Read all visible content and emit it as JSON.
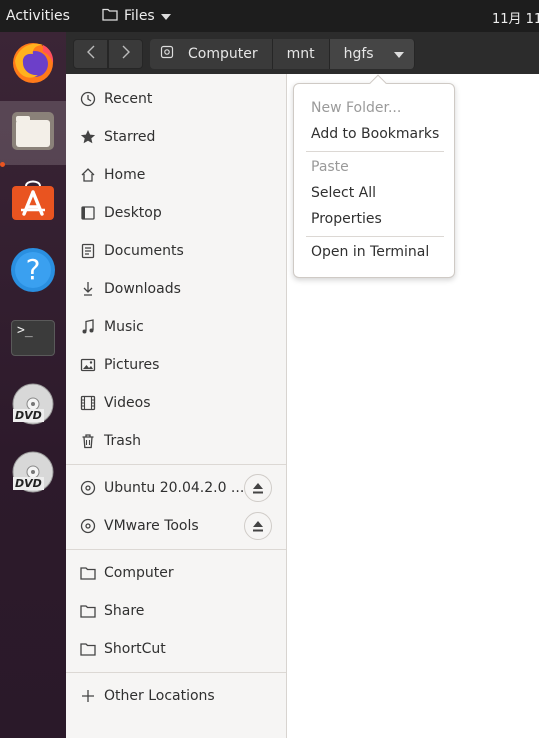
{
  "topbar": {
    "activities": "Activities",
    "app_name": "Files",
    "clock": "11月 11"
  },
  "dock": {
    "items": [
      {
        "name": "firefox-icon"
      },
      {
        "name": "files-icon"
      },
      {
        "name": "software-icon"
      },
      {
        "name": "help-icon"
      },
      {
        "name": "terminal-icon"
      },
      {
        "name": "dvd-icon"
      },
      {
        "name": "dvd-icon"
      }
    ],
    "terminal_prompt": ">_",
    "dvd_label": "DVD",
    "help_glyph": "?"
  },
  "header": {
    "back_glyph": "‹",
    "forward_glyph": "›",
    "path": [
      "Computer",
      "mnt",
      "hgfs"
    ]
  },
  "sidebar": {
    "places": [
      "Recent",
      "Starred",
      "Home",
      "Desktop",
      "Documents",
      "Downloads",
      "Music",
      "Pictures",
      "Videos",
      "Trash"
    ],
    "devices": [
      "Ubuntu 20.04.2.0 ...",
      "VMware Tools"
    ],
    "bookmarks": [
      "Computer",
      "Share",
      "ShortCut"
    ],
    "other": "Other Locations"
  },
  "popover": {
    "new_folder": "New Folder...",
    "add_bookmark": "Add to Bookmarks",
    "paste": "Paste",
    "select_all": "Select All",
    "properties": "Properties",
    "open_terminal": "Open in Terminal"
  }
}
